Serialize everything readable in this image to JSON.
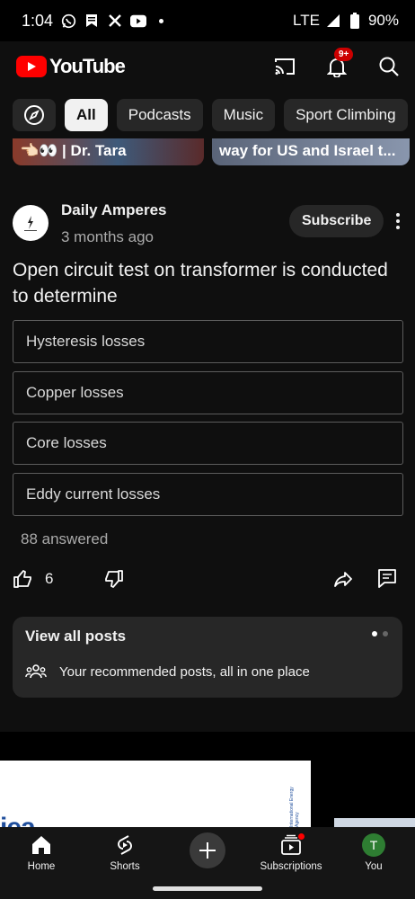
{
  "status_bar": {
    "time": "1:04",
    "network": "LTE",
    "battery": "90%",
    "icons": [
      "whatsapp-icon",
      "news-icon",
      "x-icon",
      "youtube-icon",
      "dot-icon",
      "signal-icon",
      "battery-icon"
    ]
  },
  "header": {
    "logo_text": "YouTube",
    "notification_badge": "9+",
    "brand_color": "#ff0000"
  },
  "chips": [
    {
      "label": "All",
      "active": true
    },
    {
      "label": "Podcasts",
      "active": false
    },
    {
      "label": "Music",
      "active": false
    },
    {
      "label": "Sport Climbing",
      "active": false
    }
  ],
  "thumbnails": [
    {
      "caption": "👈🏻👀 | Dr. Tara"
    },
    {
      "caption": "way for US and Israel t..."
    }
  ],
  "post": {
    "channel": "Daily Amperes",
    "time": "3 months ago",
    "subscribe_label": "Subscribe",
    "question": "Open circuit test on transformer is conducted to determine",
    "options": [
      "Hysteresis losses",
      "Copper losses",
      "Core losses",
      "Eddy current losses"
    ],
    "answered": "88 answered",
    "likes": "6"
  },
  "posts_card": {
    "title": "View all posts",
    "subtitle": "Your recommended posts, all in one place"
  },
  "ad": {
    "logo_text": "iea",
    "vertical_text": "International Energy Agency"
  },
  "bottom_nav": {
    "home": "Home",
    "shorts": "Shorts",
    "subscriptions": "Subscriptions",
    "you": "You",
    "you_initial": "T"
  }
}
